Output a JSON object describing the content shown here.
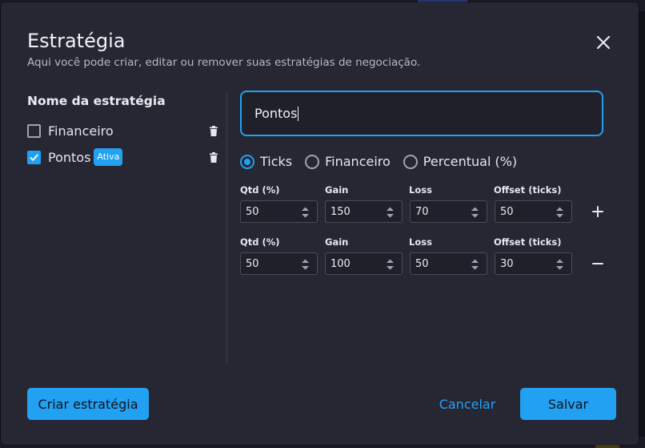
{
  "dialog": {
    "title": "Estratégia",
    "subtitle": "Aqui você pode criar, editar ou remover suas estratégias de negociação."
  },
  "strategies": {
    "section_label": "Nome da estratégia",
    "items": [
      {
        "label": "Financeiro",
        "checked": false,
        "badge": ""
      },
      {
        "label": "Pontos",
        "checked": true,
        "badge": "Ativa"
      }
    ]
  },
  "editor": {
    "name_value": "Pontos",
    "mode_options": [
      "Ticks",
      "Financeiro",
      "Percentual (%)"
    ],
    "selected_mode": "Ticks",
    "column_labels": [
      "Qtd (%)",
      "Gain",
      "Loss",
      "Offset (ticks)"
    ],
    "rows": [
      {
        "qtd": "50",
        "gain": "150",
        "loss": "70",
        "offset": "50",
        "action": "plus-icon"
      },
      {
        "qtd": "50",
        "gain": "100",
        "loss": "50",
        "offset": "30",
        "action": "minus-icon"
      }
    ]
  },
  "footer": {
    "create_label": "Criar estratégia",
    "cancel_label": "Cancelar",
    "save_label": "Salvar"
  },
  "colors": {
    "accent": "#22a1f2",
    "dialog_bg": "#262733"
  }
}
